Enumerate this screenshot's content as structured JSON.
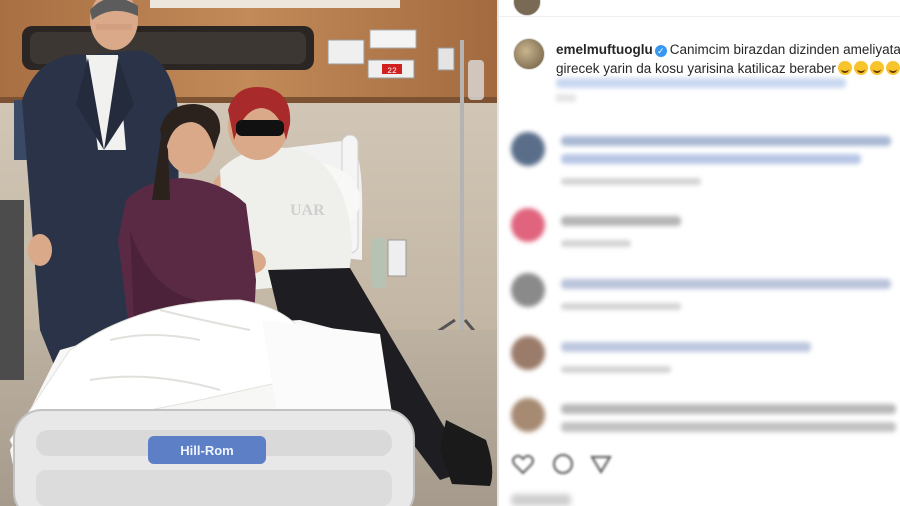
{
  "post": {
    "username": "emelmuftuoglu",
    "caption_line1": "Canimcim birazdan dizinden ameliyata",
    "caption_line2": "girecek yarin da kosu yarisina katilicaz beraber"
  },
  "photo": {
    "bed_panel_label": "Hill-Rom",
    "monitor_value": "22"
  },
  "colors": {
    "verified_badge": "#3897f0",
    "text": "#262626"
  },
  "icons": [
    "verified-badge-icon",
    "heart-icon",
    "comment-icon",
    "share-icon"
  ]
}
